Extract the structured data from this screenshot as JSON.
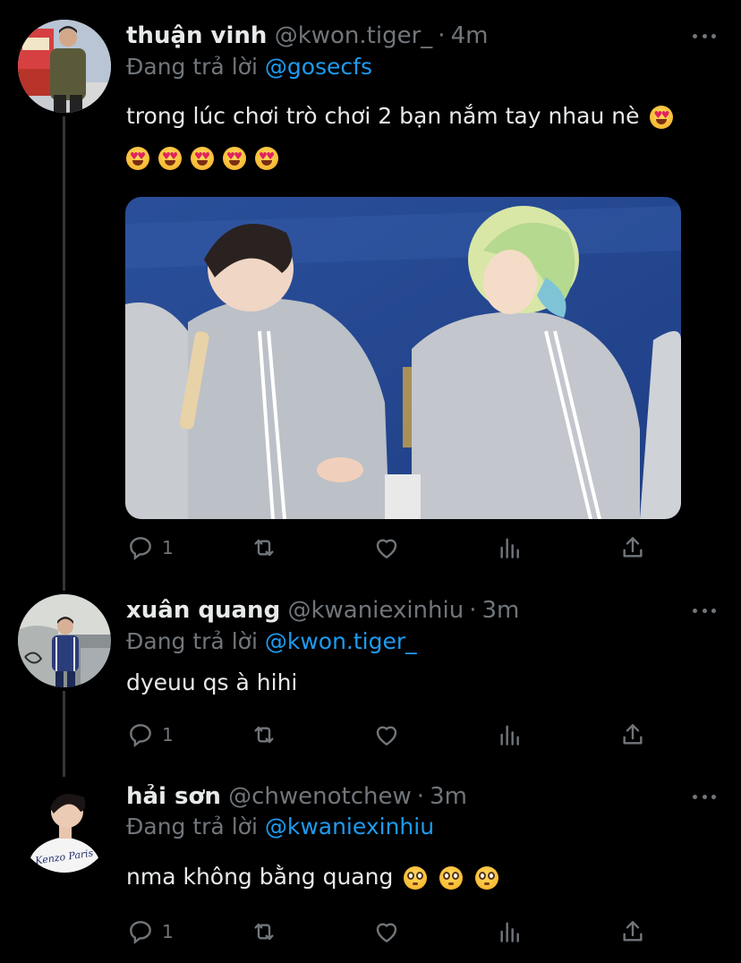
{
  "tweets": [
    {
      "display_name": "thuận vinh",
      "handle": "@kwon.tiger_",
      "time": "4m",
      "replying_prefix": "Đang trả lời",
      "replying_to": "@gosecfs",
      "text": "trong lúc chơi trò chơi 2 bạn nắm tay nhau nè",
      "emoji_extra_count": 5,
      "reply_count": "1"
    },
    {
      "display_name": "xuân quang",
      "handle": "@kwaniexinhiu",
      "time": "3m",
      "replying_prefix": "Đang trả lời",
      "replying_to": "@kwon.tiger_",
      "text": "dyeuu qs à hihi",
      "reply_count": "1"
    },
    {
      "display_name": "hải sơn",
      "handle": "@chwenotchew",
      "time": "3m",
      "replying_prefix": "Đang trả lời",
      "replying_to": "@kwaniexinhiu",
      "text": "nma không bằng quang",
      "reply_count": "1",
      "avatar_shirt_text": "Kenzo Paris"
    }
  ],
  "icons": [
    "more-icon",
    "reply-icon",
    "retweet-icon",
    "like-icon",
    "analytics-icon",
    "share-icon",
    "heart-eyes-emoji",
    "flushed-emoji"
  ],
  "colors": {
    "background": "#000000",
    "text": "#e7e9ea",
    "secondary": "#71767b",
    "link": "#1d9bf0"
  }
}
